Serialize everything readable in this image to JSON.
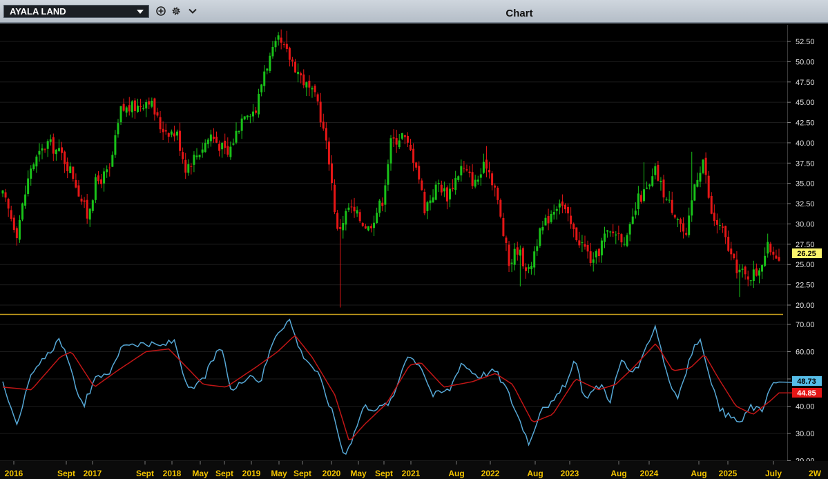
{
  "window": {
    "symbol": "AYALA LAND",
    "title": "Chart"
  },
  "icons": [
    "add-circle-icon",
    "gear-icon",
    "chevron-down-icon",
    "dropdown-caret-icon"
  ],
  "colors": {
    "up_candle": "#19c219",
    "down_candle": "#e51616",
    "osc_line": "#56a8d6",
    "signal_line": "#c21616",
    "price_badge": "#fbf56b",
    "osc_badge": "#56bde8",
    "signal_badge": "#e51616",
    "axis_text": "#f2c300",
    "divider": "#c79f1c"
  },
  "chart_data": [
    {
      "type": "candlestick",
      "title": "",
      "ylim": [
        19,
        54
      ],
      "y_ticks": [
        "52.50",
        "50.00",
        "47.50",
        "45.00",
        "42.50",
        "40.00",
        "37.50",
        "35.00",
        "32.50",
        "30.00",
        "27.50",
        "25.00",
        "22.50",
        "20.00"
      ],
      "last_price_label": "26.25",
      "period": "2W",
      "close_path": [
        [
          0,
          33.5
        ],
        [
          5,
          29
        ],
        [
          10,
          37
        ],
        [
          16,
          40
        ],
        [
          21,
          38.5
        ],
        [
          25,
          36
        ],
        [
          30,
          31
        ],
        [
          33,
          35
        ],
        [
          38,
          36.5
        ],
        [
          42,
          44
        ],
        [
          48,
          44.5
        ],
        [
          52,
          45.5
        ],
        [
          56,
          42
        ],
        [
          62,
          41
        ],
        [
          65,
          37
        ],
        [
          70,
          39
        ],
        [
          74,
          41
        ],
        [
          80,
          38.5
        ],
        [
          86,
          44
        ],
        [
          90,
          44
        ],
        [
          93,
          49
        ],
        [
          98,
          52.5
        ],
        [
          103,
          50
        ],
        [
          108,
          47
        ],
        [
          112,
          45
        ],
        [
          116,
          38
        ],
        [
          119,
          29
        ],
        [
          123,
          32
        ],
        [
          126,
          31
        ],
        [
          130,
          29.5
        ],
        [
          135,
          33
        ],
        [
          138,
          40
        ],
        [
          142,
          41
        ],
        [
          147,
          37.5
        ],
        [
          150,
          32
        ],
        [
          155,
          35
        ],
        [
          158,
          33.5
        ],
        [
          163,
          37
        ],
        [
          168,
          35
        ],
        [
          172,
          37.5
        ],
        [
          175,
          34.5
        ],
        [
          180,
          25
        ],
        [
          183,
          27
        ],
        [
          187,
          24
        ],
        [
          190,
          28
        ],
        [
          195,
          31.5
        ],
        [
          198,
          33
        ],
        [
          203,
          29
        ],
        [
          207,
          27
        ],
        [
          210,
          25
        ],
        [
          214,
          28.5
        ],
        [
          218,
          29
        ],
        [
          222,
          28
        ],
        [
          226,
          33
        ],
        [
          230,
          34.5
        ],
        [
          232,
          36.5
        ],
        [
          236,
          33
        ],
        [
          240,
          31
        ],
        [
          243,
          28
        ],
        [
          246,
          35
        ],
        [
          249,
          38
        ],
        [
          252,
          31
        ],
        [
          256,
          29
        ],
        [
          260,
          25
        ],
        [
          264,
          23.5
        ],
        [
          268,
          24
        ],
        [
          272,
          27
        ],
        [
          276,
          26.25
        ]
      ],
      "highs": [
        {
          "x": 101,
          "y": 53.8
        },
        {
          "x": 245,
          "y": 38.9
        },
        {
          "x": 228,
          "y": 37.6
        },
        {
          "x": 172,
          "y": 39.6
        }
      ],
      "lows": [
        {
          "x": 120,
          "y": 19.7
        },
        {
          "x": 184,
          "y": 22.3
        },
        {
          "x": 262,
          "y": 21
        }
      ]
    },
    {
      "type": "line",
      "title": "",
      "ylim": [
        20,
        72
      ],
      "y_ticks": [
        "70.00",
        "60.00",
        "50.00",
        "40.00",
        "30.00",
        "20.00"
      ],
      "series": [
        {
          "values_path": [
            [
              0,
              49
            ],
            [
              5,
              34
            ],
            [
              10,
              51
            ],
            [
              20,
              65
            ],
            [
              24,
              52
            ],
            [
              28,
              40
            ],
            [
              33,
              51
            ],
            [
              38,
              53
            ],
            [
              42,
              63
            ],
            [
              48,
              63
            ],
            [
              55,
              62
            ],
            [
              60,
              64
            ],
            [
              65,
              45
            ],
            [
              70,
              50
            ],
            [
              76,
              62
            ],
            [
              80,
              45
            ],
            [
              86,
              52
            ],
            [
              90,
              49
            ],
            [
              95,
              66
            ],
            [
              100,
              72
            ],
            [
              104,
              60
            ],
            [
              110,
              52
            ],
            [
              116,
              35
            ],
            [
              119,
              22
            ],
            [
              122,
              28
            ],
            [
              126,
              40
            ],
            [
              131,
              39
            ],
            [
              136,
              42
            ],
            [
              141,
              59
            ],
            [
              146,
              55
            ],
            [
              150,
              44
            ],
            [
              156,
              46
            ],
            [
              160,
              56
            ],
            [
              166,
              51
            ],
            [
              172,
              53
            ],
            [
              176,
              46
            ],
            [
              180,
              36
            ],
            [
              184,
              26
            ],
            [
              188,
              40
            ],
            [
              192,
              41
            ],
            [
              197,
              49
            ],
            [
              200,
              57
            ],
            [
              203,
              43
            ],
            [
              209,
              48
            ],
            [
              212,
              42
            ],
            [
              216,
              57
            ],
            [
              219,
              53
            ],
            [
              222,
              53
            ],
            [
              225,
              63
            ],
            [
              228,
              70
            ],
            [
              230,
              60
            ],
            [
              233,
              48
            ],
            [
              236,
              43
            ],
            [
              240,
              58
            ],
            [
              243,
              65
            ],
            [
              246,
              55
            ],
            [
              250,
              39
            ],
            [
              254,
              36
            ],
            [
              258,
              34
            ],
            [
              261,
              40
            ],
            [
              265,
              38
            ],
            [
              268,
              48
            ],
            [
              271,
              48.73
            ]
          ]
        },
        {
          "values_path": [
            [
              0,
              47
            ],
            [
              10,
              46
            ],
            [
              20,
              58
            ],
            [
              24,
              60
            ],
            [
              32,
              47
            ],
            [
              40,
              53
            ],
            [
              50,
              60
            ],
            [
              58,
              61
            ],
            [
              70,
              48
            ],
            [
              78,
              47
            ],
            [
              88,
              54
            ],
            [
              96,
              60
            ],
            [
              102,
              66
            ],
            [
              108,
              58
            ],
            [
              116,
              44
            ],
            [
              121,
              27
            ],
            [
              126,
              33
            ],
            [
              134,
              41
            ],
            [
              142,
              55
            ],
            [
              146,
              56
            ],
            [
              154,
              47
            ],
            [
              164,
              49
            ],
            [
              172,
              52
            ],
            [
              178,
              48
            ],
            [
              185,
              34
            ],
            [
              192,
              37
            ],
            [
              200,
              50
            ],
            [
              208,
              46
            ],
            [
              214,
              48
            ],
            [
              220,
              54
            ],
            [
              228,
              63
            ],
            [
              234,
              53
            ],
            [
              240,
              54
            ],
            [
              245,
              59
            ],
            [
              250,
              50
            ],
            [
              256,
              40
            ],
            [
              262,
              37
            ],
            [
              268,
              42
            ],
            [
              271,
              44.85
            ]
          ]
        }
      ],
      "last_value_labels": [
        "48.73",
        "44.85"
      ]
    }
  ],
  "x_axis": {
    "ticks": [
      "2016",
      "Sept",
      "2017",
      "Sept",
      "2018",
      "May",
      "Sept",
      "2019",
      "May",
      "Sept",
      "2020",
      "May",
      "Sept",
      "2021",
      "Aug",
      "2022",
      "Aug",
      "2023",
      "Aug",
      "2024",
      "Aug",
      "2025",
      "July"
    ],
    "period_label": "2W"
  }
}
